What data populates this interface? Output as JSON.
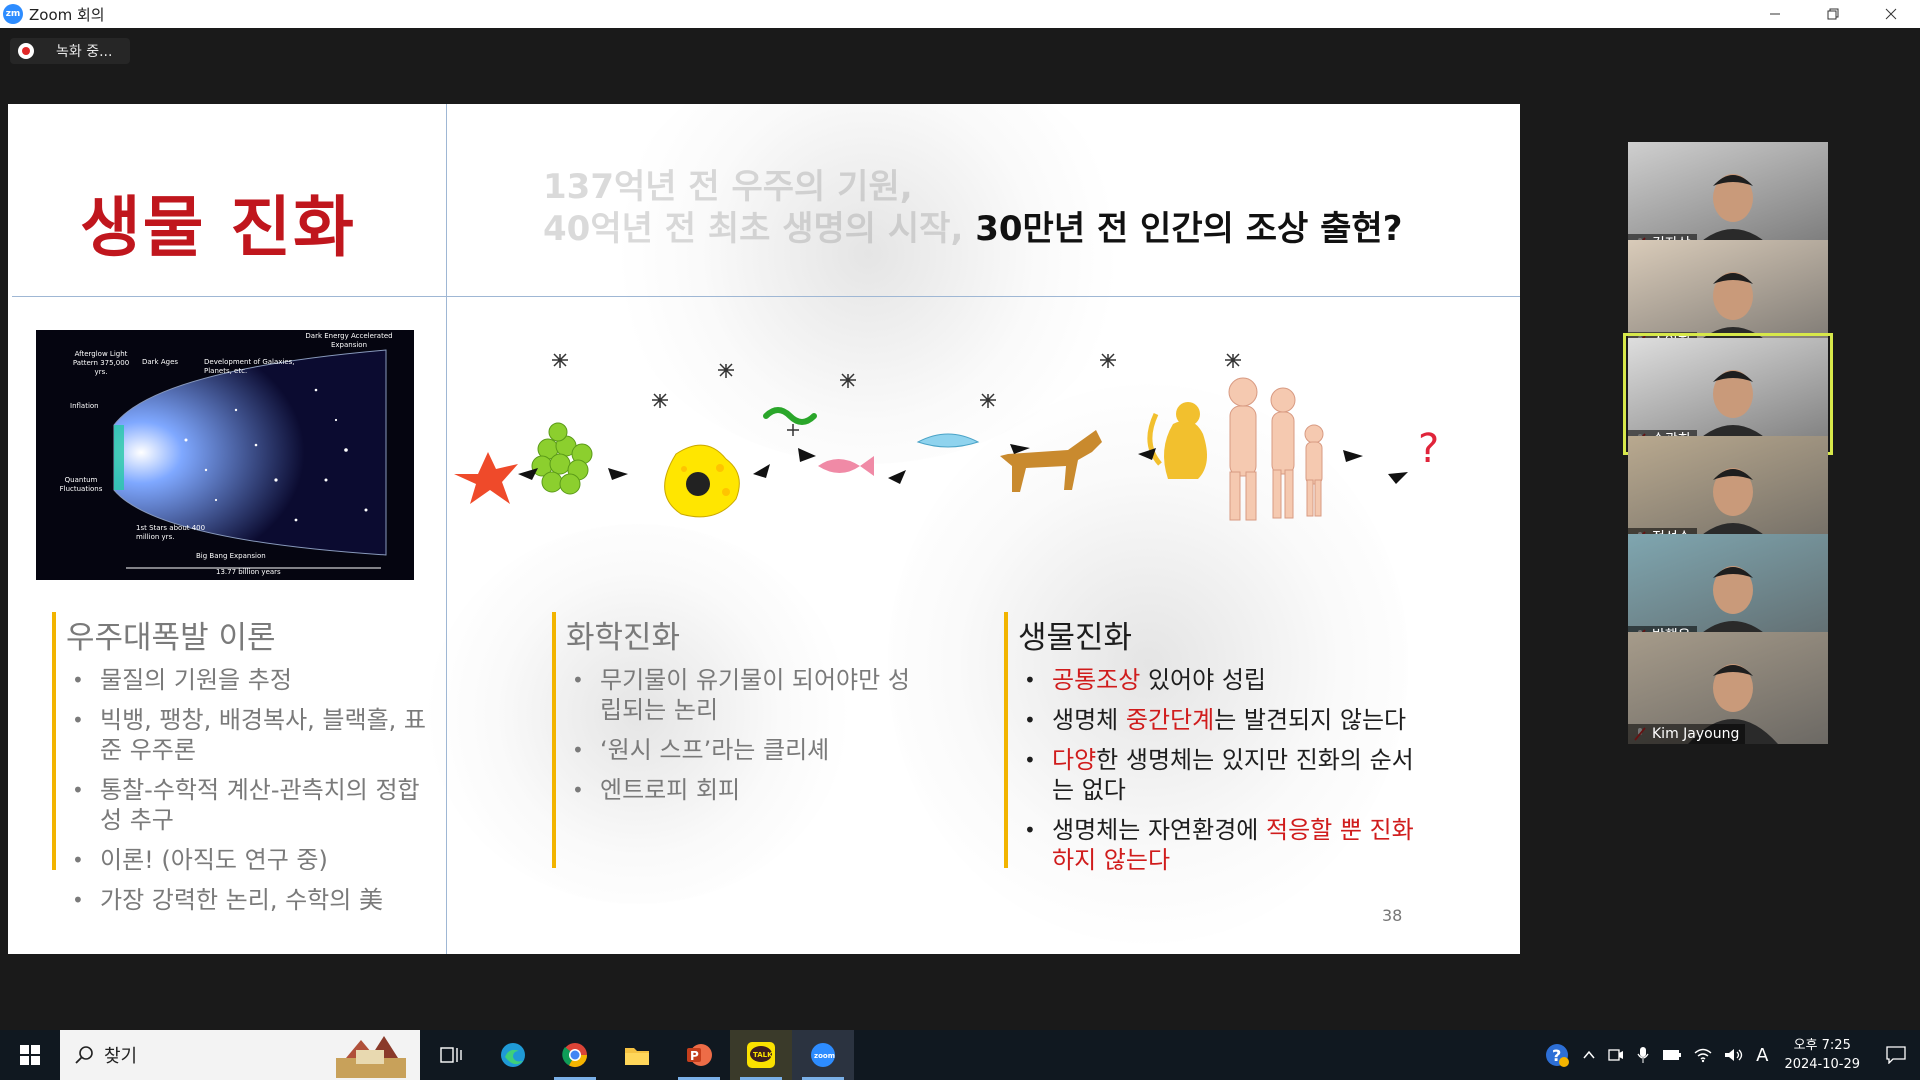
{
  "window": {
    "title": "Zoom 회의",
    "logo_text": "zm"
  },
  "recording": {
    "label": "녹화 중..."
  },
  "slide": {
    "title": "생물 진화",
    "headline_faded_1": "137억년 전 우주의 기원,",
    "headline_faded_2": "40억년 전 최초 생명의 시작,",
    "headline_strong": "30만년 전 인간의 조상 출현?",
    "universe_labels": {
      "afterglow": "Afterglow Light Pattern 375,000 yrs.",
      "dark_ages": "Dark Ages",
      "development": "Development of Galaxies, Planets, etc.",
      "dark_energy": "Dark Energy Accelerated Expansion",
      "inflation": "Inflation",
      "quantum": "Quantum Fluctuations",
      "first_stars": "1st Stars about 400 million yrs.",
      "big_bang": "Big Bang Expansion",
      "years": "13.77 billion years"
    },
    "columns": [
      {
        "heading": "우주대폭발 이론",
        "items": [
          [
            {
              "t": "물질의 기원을 추정"
            }
          ],
          [
            {
              "t": "빅뱅, 팽창, 배경복사, 블랙홀, 표준 우주론"
            }
          ],
          [
            {
              "t": "통찰-수학적 계산-관측치의 정합성 추구"
            }
          ],
          [
            {
              "t": "이론! (아직도 연구 중)"
            }
          ],
          [
            {
              "t": "가장 강력한 논리, 수학의 美"
            }
          ]
        ]
      },
      {
        "heading": "화학진화",
        "items": [
          [
            {
              "t": "무기물이 유기물이 되어야만 성립되는 논리"
            }
          ],
          [
            {
              "t": "‘원시 스프’라는 클리셰"
            }
          ],
          [
            {
              "t": "엔트로피 회피"
            }
          ]
        ]
      },
      {
        "heading": "생물진화",
        "items": [
          [
            {
              "t": "공통조상",
              "red": true
            },
            {
              "t": " 있어야 성립"
            }
          ],
          [
            {
              "t": "생명체 "
            },
            {
              "t": "중간단계",
              "red": true
            },
            {
              "t": "는 발견되지 않는다"
            }
          ],
          [
            {
              "t": "다양",
              "red": true
            },
            {
              "t": "한 생명체는 있지만 진화의 순서는 없다"
            }
          ],
          [
            {
              "t": "생명체는 자연환경에 "
            },
            {
              "t": "적응할 뿐 진화하지 않는다",
              "red": true
            }
          ]
        ]
      }
    ],
    "page_number": "38"
  },
  "participants": [
    {
      "name": "김자상",
      "bg": "#cfcfcf"
    },
    {
      "name": "조인희",
      "bg": "#d9cbb9"
    },
    {
      "name": "손광희",
      "bg": "#dedede",
      "active": true
    },
    {
      "name": "정성수",
      "bg": "#b9a98f"
    },
    {
      "name": "박행운",
      "bg": "#7fa6b0"
    },
    {
      "name": "Kim Jayoung",
      "bg": "#a69b8a"
    }
  ],
  "taskbar": {
    "search_label": "찾기",
    "clock_time": "오후 7:25",
    "clock_date": "2024-10-29",
    "ime": "A",
    "apps": [
      "task-view",
      "edge",
      "chrome",
      "file-explorer",
      "powerpoint",
      "kakaotalk",
      "zoom"
    ]
  },
  "colors": {
    "title_red": "#c0161d",
    "accent_bar": "#f2b400",
    "zoom_blue": "#2D8CFF",
    "active_tile": "#d7e84a"
  }
}
